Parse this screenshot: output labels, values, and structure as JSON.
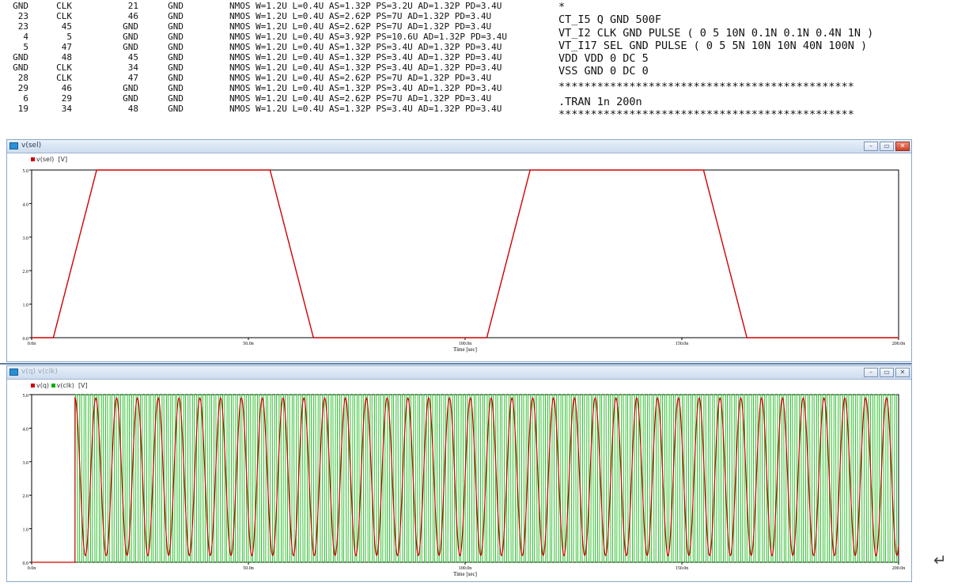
{
  "netlist": {
    "rows": [
      [
        "GND",
        "CLK",
        "21",
        "GND",
        "NMOS W=1.2U L=0.4U AS=1.32P PS=3.2U AD=1.32P PD=3.4U"
      ],
      [
        "23",
        "CLK",
        "46",
        "GND",
        "NMOS W=1.2U L=0.4U AS=2.62P PS=7U AD=1.32P PD=3.4U"
      ],
      [
        "23",
        "45",
        "GND",
        "GND",
        "NMOS W=1.2U L=0.4U AS=2.62P PS=7U AD=1.32P PD=3.4U"
      ],
      [
        "4",
        "5",
        "GND",
        "GND",
        "NMOS W=1.2U L=0.4U AS=3.92P PS=10.6U AD=1.32P PD=3.4U"
      ],
      [
        "5",
        "47",
        "GND",
        "GND",
        "NMOS W=1.2U L=0.4U AS=1.32P PS=3.4U AD=1.32P PD=3.4U"
      ],
      [
        "GND",
        "48",
        "45",
        "GND",
        "NMOS W=1.2U L=0.4U AS=1.32P PS=3.4U AD=1.32P PD=3.4U"
      ],
      [
        "GND",
        "CLK",
        "34",
        "GND",
        "NMOS W=1.2U L=0.4U AS=1.32P PS=3.4U AD=1.32P PD=3.4U"
      ],
      [
        "28",
        "CLK",
        "47",
        "GND",
        "NMOS W=1.2U L=0.4U AS=2.62P PS=7U AD=1.32P PD=3.4U"
      ],
      [
        "29",
        "46",
        "GND",
        "GND",
        "NMOS W=1.2U L=0.4U AS=1.32P PS=3.4U AD=1.32P PD=3.4U"
      ],
      [
        "6",
        "29",
        "GND",
        "GND",
        "NMOS W=1.2U L=0.4U AS=2.62P PS=7U AD=1.32P PD=3.4U"
      ],
      [
        "19",
        "34",
        "48",
        "GND",
        "NMOS W=1.2U L=0.4U AS=1.32P PS=3.4U AD=1.32P PD=3.4U"
      ]
    ]
  },
  "spice": {
    "lines": [
      "*",
      "CT_I5 Q GND 500F",
      "VT_I2 CLK GND PULSE ( 0 5 10N 0.1N 0.1N 0.4N 1N )",
      "VT_I17 SEL GND PULSE ( 0 5 5N 10N 10N 40N 100N )",
      "VDD VDD 0 DC 5",
      "VSS GND 0 DC 0",
      "**********************************************",
      ".TRAN 1n 200n",
      "**********************************************"
    ]
  },
  "windows": {
    "top": {
      "title": "v(sel)",
      "legend": [
        {
          "label": "v(sel)",
          "color": "#d00000"
        }
      ],
      "unit": "[V]",
      "buttons": {
        "min": "–",
        "max": "▭",
        "close": "✕"
      }
    },
    "bottom": {
      "title": "v(q) v(clk)",
      "legend": [
        {
          "label": "v(q)",
          "color": "#d00000"
        },
        {
          "label": "v(clk)",
          "color": "#00b000"
        }
      ],
      "unit": "[V]",
      "buttons": {
        "min": "–",
        "max": "▭",
        "close": "✕"
      }
    }
  },
  "chart_data": [
    {
      "type": "line",
      "title": "v(sel)",
      "xlabel": "Time [sec]",
      "ylabel": "[V]",
      "x_ticks": [
        "0.0n",
        "50.0n",
        "100.0n",
        "150.0n",
        "200.0n"
      ],
      "y_ticks": [
        "0.0",
        "1.0",
        "2.0",
        "3.0",
        "4.0",
        "5.0"
      ],
      "xlim": [
        0,
        200
      ],
      "ylim": [
        0,
        5
      ],
      "series": [
        {
          "name": "v(sel)",
          "color": "#d00000",
          "x": [
            0,
            5,
            15,
            55,
            65,
            105,
            115,
            155,
            165,
            200
          ],
          "y": [
            0,
            0,
            5,
            5,
            0,
            0,
            5,
            5,
            0,
            0
          ]
        }
      ]
    },
    {
      "type": "line",
      "title": "v(q) v(clk)",
      "xlabel": "Time [sec]",
      "ylabel": "[V]",
      "x_ticks": [
        "0.0n",
        "50.0n",
        "100.0n",
        "150.0n",
        "200.0n"
      ],
      "y_ticks": [
        "0.0",
        "1.0",
        "2.0",
        "3.0",
        "4.0",
        "5.0"
      ],
      "xlim": [
        0,
        200
      ],
      "ylim": [
        0,
        5
      ],
      "series": [
        {
          "name": "v(clk)",
          "color": "#00b000",
          "pulse": {
            "low": 0,
            "high": 5,
            "delay": 10,
            "period": 1,
            "width": 0.4,
            "rise": 0.1,
            "fall": 0.1
          }
        },
        {
          "name": "v(q)",
          "color": "#d00000",
          "oscillation": {
            "start": 10,
            "min": 0.2,
            "max": 4.9,
            "period": 4.8
          }
        }
      ]
    }
  ],
  "footer_mark": "↵"
}
